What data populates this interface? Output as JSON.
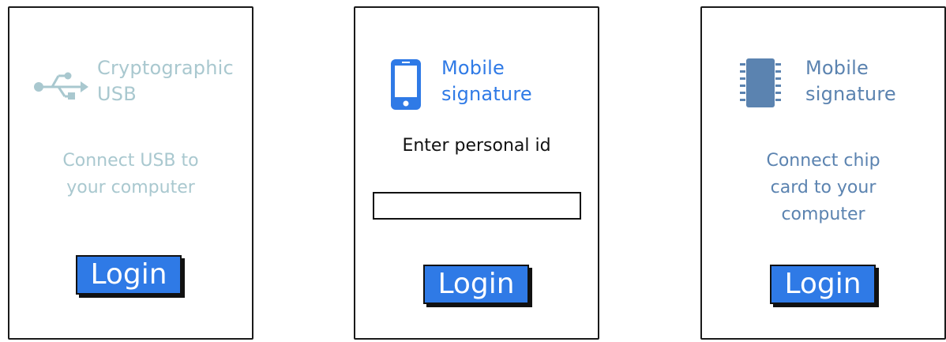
{
  "colors": {
    "usb_muted": "#a9c8cf",
    "mobile_blue": "#2f7ae6",
    "chip_slate": "#5b83b0",
    "login_button": "#2f7ae6",
    "border": "#1a1a1a"
  },
  "cards": [
    {
      "icon": "usb-icon",
      "title_line1": "Cryptographic",
      "title_line2": "USB",
      "description_line1": "Connect USB to",
      "description_line2": "your computer",
      "login_label": "Login"
    },
    {
      "icon": "mobile-phone-icon",
      "title_line1": "Mobile",
      "title_line2": "signature",
      "prompt": "Enter personal id",
      "input_value": "",
      "login_label": "Login"
    },
    {
      "icon": "chip-icon",
      "title_line1": "Mobile",
      "title_line2": "signature",
      "description_line1": "Connect chip",
      "description_line2": "card to your",
      "description_line3": "computer",
      "login_label": "Login"
    }
  ]
}
